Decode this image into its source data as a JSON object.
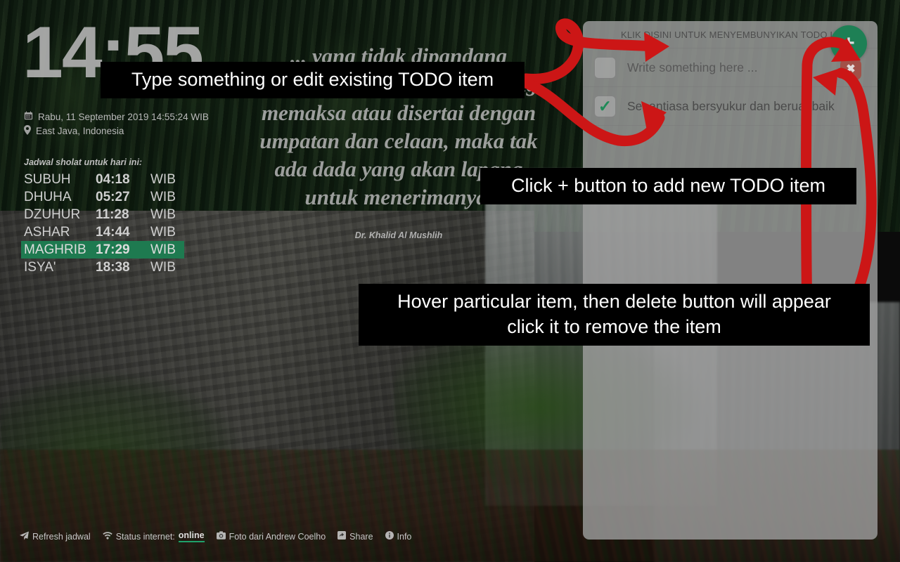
{
  "clock": {
    "time": "14:55"
  },
  "meta": {
    "datetime": "Rabu, 11 September 2019 14:55:24 WIB",
    "datetime_icon": "calendar-icon",
    "location": "East Java, Indonesia",
    "location_icon": "map-pin-icon"
  },
  "prayer": {
    "title": "Jadwal sholat untuk hari ini:",
    "timezone_label": "WIB",
    "active": "MAGHRIB",
    "rows": [
      {
        "name": "SUBUH",
        "time": "04:18",
        "tz": "WIB",
        "active": false
      },
      {
        "name": "DHUHA",
        "time": "05:27",
        "tz": "WIB",
        "active": false
      },
      {
        "name": "DZUHUR",
        "time": "11:28",
        "tz": "WIB",
        "active": false
      },
      {
        "name": "ASHAR",
        "time": "14:44",
        "tz": "WIB",
        "active": false
      },
      {
        "name": "MAGHRIB",
        "time": "17:29",
        "tz": "WIB",
        "active": true
      },
      {
        "name": "ISYA'",
        "time": "18:38",
        "tz": "WIB",
        "active": false
      }
    ]
  },
  "quote": {
    "line1": "... yang tidak dipandang",
    "line2": "menyinggung, menyakiti, yang",
    "line3": "memaksa atau disertai dengan",
    "line4": "umpatan dan celaan, maka tak",
    "line5": "ada dada yang akan lapang",
    "line6": "untuk menerimanya.",
    "author": "Dr. Khalid Al Mushlih"
  },
  "footer": {
    "refresh": "Refresh jadwal",
    "refresh_icon": "paper-plane-icon",
    "status_label": "Status internet:",
    "status_value": "online",
    "status_icon": "wifi-icon",
    "photo_credit": "Foto dari Andrew Coelho",
    "photo_icon": "camera-icon",
    "share": "Share",
    "share_icon": "share-icon",
    "info": "Info",
    "info_icon": "info-circle-icon"
  },
  "todo": {
    "header": "KLIK DISINI UNTUK MENYEMBUNYIKAN TODO LIST",
    "add_label": "+",
    "add_icon": "plus-icon",
    "delete_label": "✖",
    "delete_icon": "close-icon",
    "items": [
      {
        "text": "Write something here ...",
        "checked": false,
        "placeholder": true
      },
      {
        "text": "Senantiasa bersyukur dan beruat baik",
        "checked": true,
        "placeholder": false
      }
    ]
  },
  "annotations": {
    "callout1": "Type something or edit existing TODO item",
    "callout2": "Click + button to add new TODO item",
    "callout3_line1": "Hover particular item, then delete button will appear",
    "callout3_line2": "click it to remove the item",
    "arrow_color": "#cc1616"
  },
  "colors": {
    "accent_green": "#1e8055",
    "prayer_active": "#1e7a50",
    "delete_red": "#a15148",
    "panel_bg": "#a0a0a0",
    "callout_bg": "#000000"
  }
}
